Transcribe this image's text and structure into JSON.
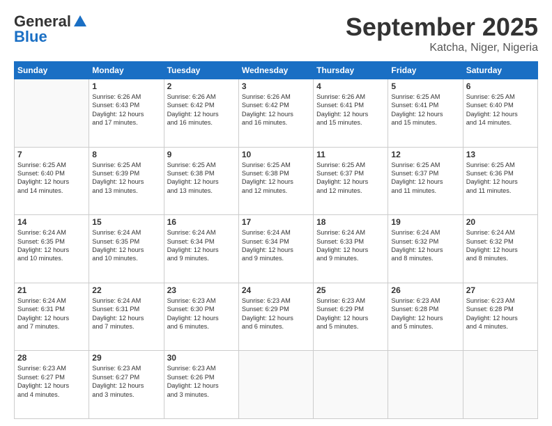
{
  "header": {
    "logo_general": "General",
    "logo_blue": "Blue",
    "title": "September 2025",
    "subtitle": "Katcha, Niger, Nigeria"
  },
  "days_of_week": [
    "Sunday",
    "Monday",
    "Tuesday",
    "Wednesday",
    "Thursday",
    "Friday",
    "Saturday"
  ],
  "weeks": [
    [
      {
        "day": "",
        "info": ""
      },
      {
        "day": "1",
        "info": "Sunrise: 6:26 AM\nSunset: 6:43 PM\nDaylight: 12 hours\nand 17 minutes."
      },
      {
        "day": "2",
        "info": "Sunrise: 6:26 AM\nSunset: 6:42 PM\nDaylight: 12 hours\nand 16 minutes."
      },
      {
        "day": "3",
        "info": "Sunrise: 6:26 AM\nSunset: 6:42 PM\nDaylight: 12 hours\nand 16 minutes."
      },
      {
        "day": "4",
        "info": "Sunrise: 6:26 AM\nSunset: 6:41 PM\nDaylight: 12 hours\nand 15 minutes."
      },
      {
        "day": "5",
        "info": "Sunrise: 6:25 AM\nSunset: 6:41 PM\nDaylight: 12 hours\nand 15 minutes."
      },
      {
        "day": "6",
        "info": "Sunrise: 6:25 AM\nSunset: 6:40 PM\nDaylight: 12 hours\nand 14 minutes."
      }
    ],
    [
      {
        "day": "7",
        "info": "Sunrise: 6:25 AM\nSunset: 6:40 PM\nDaylight: 12 hours\nand 14 minutes."
      },
      {
        "day": "8",
        "info": "Sunrise: 6:25 AM\nSunset: 6:39 PM\nDaylight: 12 hours\nand 13 minutes."
      },
      {
        "day": "9",
        "info": "Sunrise: 6:25 AM\nSunset: 6:38 PM\nDaylight: 12 hours\nand 13 minutes."
      },
      {
        "day": "10",
        "info": "Sunrise: 6:25 AM\nSunset: 6:38 PM\nDaylight: 12 hours\nand 12 minutes."
      },
      {
        "day": "11",
        "info": "Sunrise: 6:25 AM\nSunset: 6:37 PM\nDaylight: 12 hours\nand 12 minutes."
      },
      {
        "day": "12",
        "info": "Sunrise: 6:25 AM\nSunset: 6:37 PM\nDaylight: 12 hours\nand 11 minutes."
      },
      {
        "day": "13",
        "info": "Sunrise: 6:25 AM\nSunset: 6:36 PM\nDaylight: 12 hours\nand 11 minutes."
      }
    ],
    [
      {
        "day": "14",
        "info": "Sunrise: 6:24 AM\nSunset: 6:35 PM\nDaylight: 12 hours\nand 10 minutes."
      },
      {
        "day": "15",
        "info": "Sunrise: 6:24 AM\nSunset: 6:35 PM\nDaylight: 12 hours\nand 10 minutes."
      },
      {
        "day": "16",
        "info": "Sunrise: 6:24 AM\nSunset: 6:34 PM\nDaylight: 12 hours\nand 9 minutes."
      },
      {
        "day": "17",
        "info": "Sunrise: 6:24 AM\nSunset: 6:34 PM\nDaylight: 12 hours\nand 9 minutes."
      },
      {
        "day": "18",
        "info": "Sunrise: 6:24 AM\nSunset: 6:33 PM\nDaylight: 12 hours\nand 9 minutes."
      },
      {
        "day": "19",
        "info": "Sunrise: 6:24 AM\nSunset: 6:32 PM\nDaylight: 12 hours\nand 8 minutes."
      },
      {
        "day": "20",
        "info": "Sunrise: 6:24 AM\nSunset: 6:32 PM\nDaylight: 12 hours\nand 8 minutes."
      }
    ],
    [
      {
        "day": "21",
        "info": "Sunrise: 6:24 AM\nSunset: 6:31 PM\nDaylight: 12 hours\nand 7 minutes."
      },
      {
        "day": "22",
        "info": "Sunrise: 6:24 AM\nSunset: 6:31 PM\nDaylight: 12 hours\nand 7 minutes."
      },
      {
        "day": "23",
        "info": "Sunrise: 6:23 AM\nSunset: 6:30 PM\nDaylight: 12 hours\nand 6 minutes."
      },
      {
        "day": "24",
        "info": "Sunrise: 6:23 AM\nSunset: 6:29 PM\nDaylight: 12 hours\nand 6 minutes."
      },
      {
        "day": "25",
        "info": "Sunrise: 6:23 AM\nSunset: 6:29 PM\nDaylight: 12 hours\nand 5 minutes."
      },
      {
        "day": "26",
        "info": "Sunrise: 6:23 AM\nSunset: 6:28 PM\nDaylight: 12 hours\nand 5 minutes."
      },
      {
        "day": "27",
        "info": "Sunrise: 6:23 AM\nSunset: 6:28 PM\nDaylight: 12 hours\nand 4 minutes."
      }
    ],
    [
      {
        "day": "28",
        "info": "Sunrise: 6:23 AM\nSunset: 6:27 PM\nDaylight: 12 hours\nand 4 minutes."
      },
      {
        "day": "29",
        "info": "Sunrise: 6:23 AM\nSunset: 6:27 PM\nDaylight: 12 hours\nand 3 minutes."
      },
      {
        "day": "30",
        "info": "Sunrise: 6:23 AM\nSunset: 6:26 PM\nDaylight: 12 hours\nand 3 minutes."
      },
      {
        "day": "",
        "info": ""
      },
      {
        "day": "",
        "info": ""
      },
      {
        "day": "",
        "info": ""
      },
      {
        "day": "",
        "info": ""
      }
    ]
  ]
}
